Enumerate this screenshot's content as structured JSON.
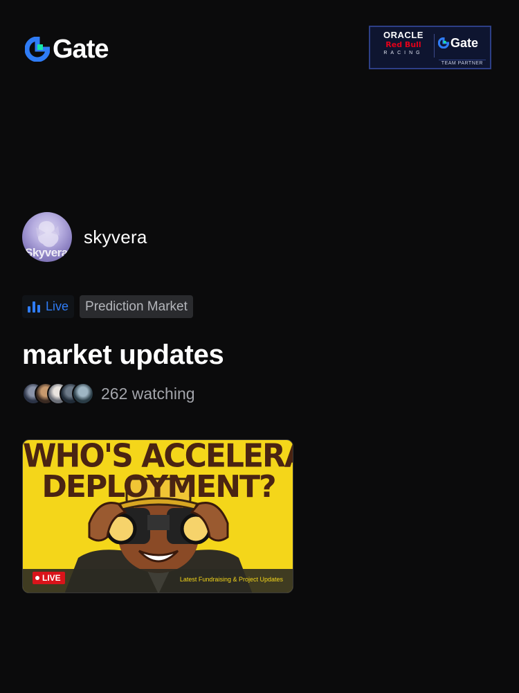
{
  "brand": {
    "logo_text": "Gate",
    "accent": "#2f7cf6",
    "logo_green": "#17e5a6"
  },
  "partner": {
    "oracle": "ORACLE",
    "redbull": "Red Bull",
    "racing": "RACING",
    "gate": "Gate",
    "team_partner": "TEAM PARTNER"
  },
  "host": {
    "name": "skyvera",
    "avatar_text": "Skyvera"
  },
  "tags": {
    "live_label": "Live",
    "live_icon": "live-bars-icon",
    "category": "Prediction Market"
  },
  "stream": {
    "title": "market updates",
    "watching": "262 watching",
    "viewer_avatar_count": 5
  },
  "thumbnail": {
    "headline_1": "WHO'S ACCELERATING",
    "headline_2": "DEPLOYMENT?",
    "live_badge": "LIVE",
    "caption": "Latest Fundraising & Project Updates",
    "background": "#f4d61a"
  }
}
